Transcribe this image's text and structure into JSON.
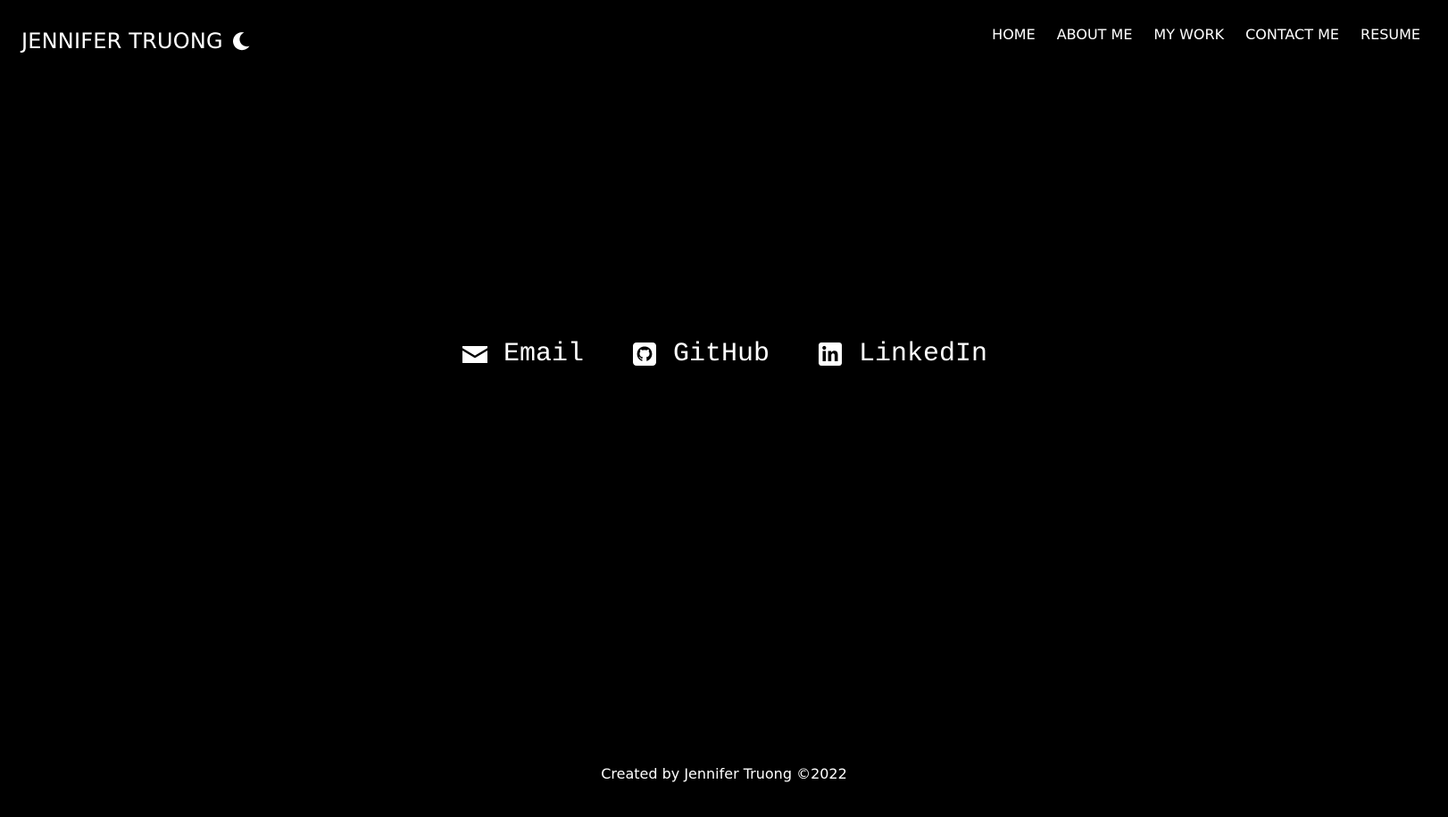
{
  "colors": {
    "background": "#000000",
    "text": "#ffffff"
  },
  "header": {
    "brand": "JENNIFER TRUONG",
    "theme_toggle_icon": "moon-icon"
  },
  "nav": {
    "items": [
      {
        "label": "HOME"
      },
      {
        "label": "ABOUT ME"
      },
      {
        "label": "MY WORK"
      },
      {
        "label": "CONTACT ME"
      },
      {
        "label": "RESUME"
      }
    ]
  },
  "contact": {
    "links": [
      {
        "label": "Email",
        "icon": "envelope-icon"
      },
      {
        "label": "GitHub",
        "icon": "github-icon"
      },
      {
        "label": "LinkedIn",
        "icon": "linkedin-icon"
      }
    ]
  },
  "footer": {
    "text": "Created by Jennifer Truong ©2022"
  }
}
